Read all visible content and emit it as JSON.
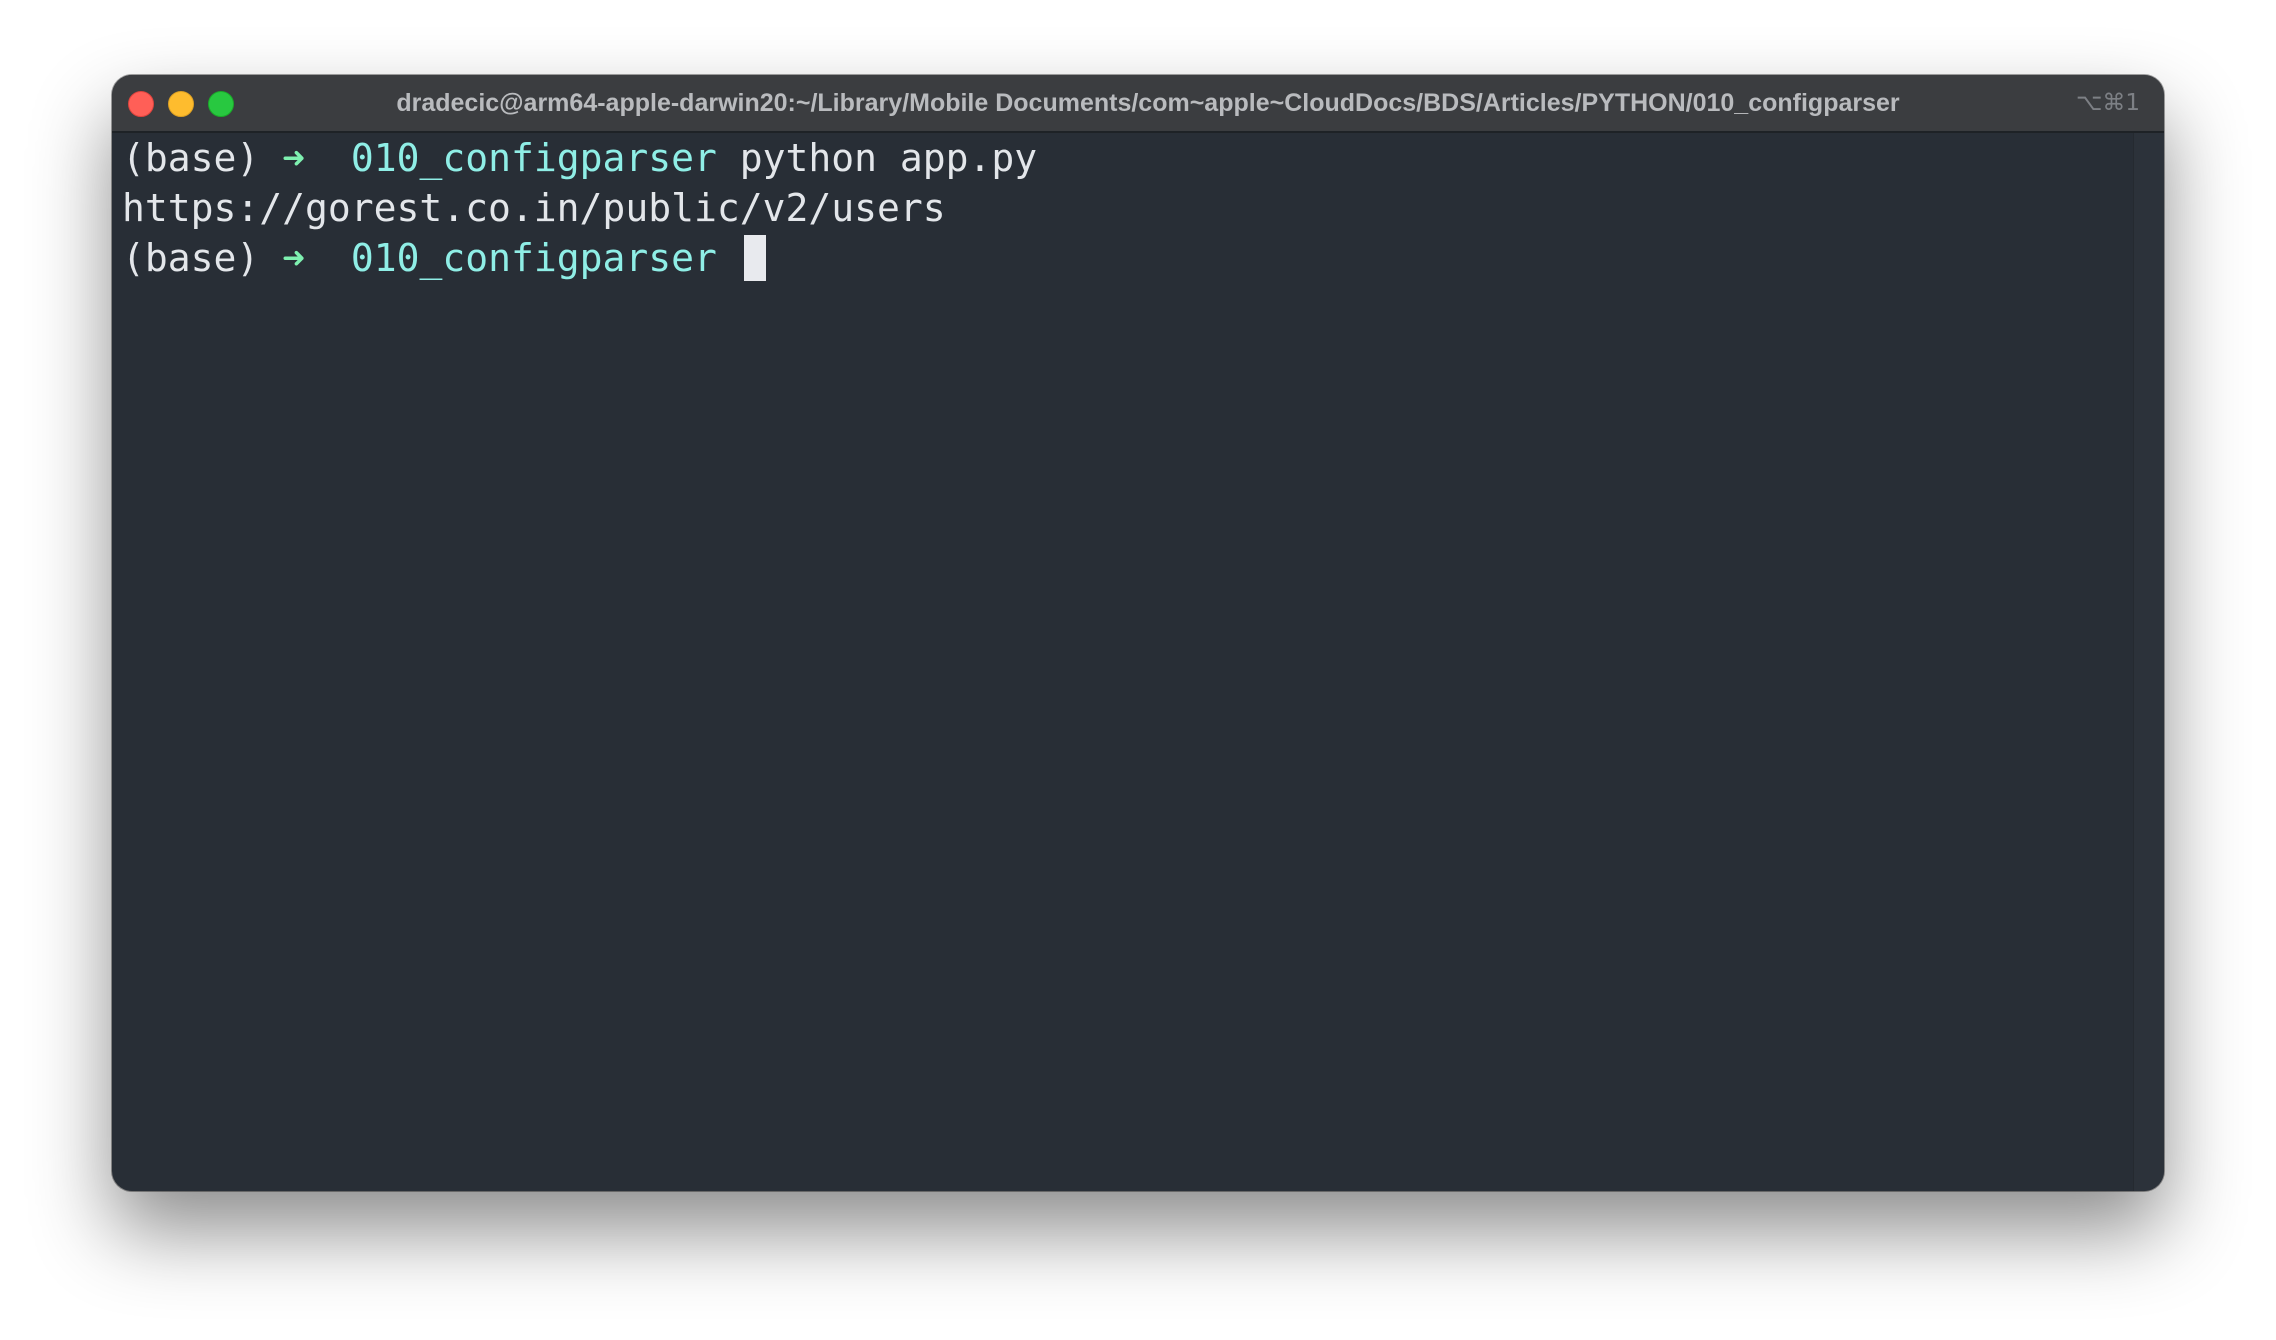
{
  "window": {
    "title": "dradecic@arm64-apple-darwin20:~/Library/Mobile Documents/com~apple~CloudDocs/BDS/Articles/PYTHON/010_configparser",
    "shortcut": "⌥⌘1"
  },
  "terminal": {
    "lines": [
      {
        "env": "(base)",
        "arrow": "➜",
        "dir": "010_configparser",
        "command": "python app.py"
      },
      {
        "output": "https://gorest.co.in/public/v2/users"
      },
      {
        "env": "(base)",
        "arrow": "➜",
        "dir": "010_configparser",
        "command": ""
      }
    ]
  },
  "colors": {
    "background": "#282e36",
    "titlebar": "#3b3d40",
    "text": "#e3e6ea",
    "arrow": "#7ef0b0",
    "directory": "#8feee6",
    "close": "#ff5f57",
    "minimize": "#febc2e",
    "maximize": "#28c840"
  }
}
